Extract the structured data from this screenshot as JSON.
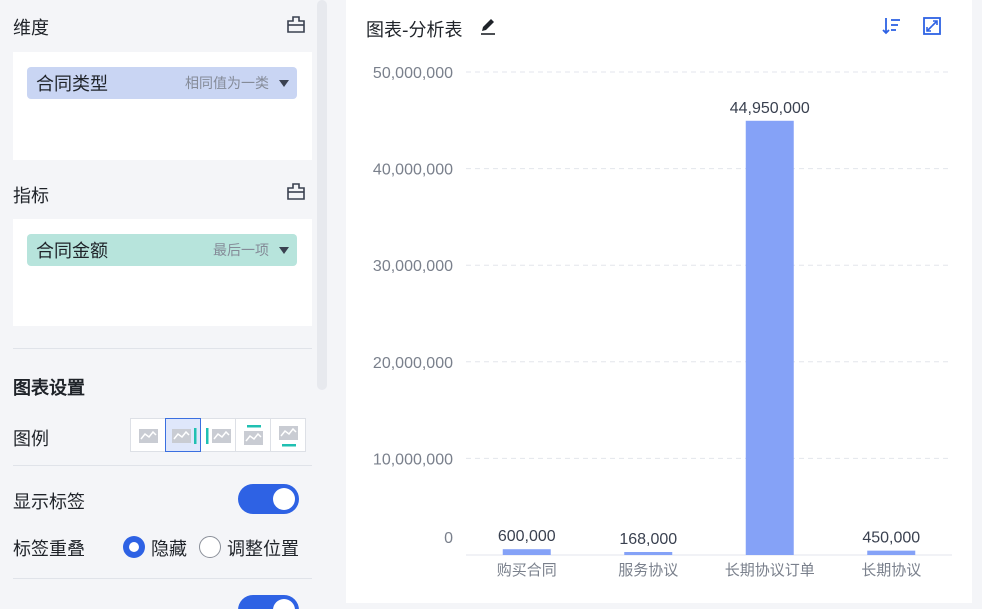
{
  "sidebar": {
    "dimension_title": "维度",
    "dimension_field": {
      "name": "合同类型",
      "aggregation": "相同值为一类"
    },
    "measure_title": "指标",
    "measure_field": {
      "name": "合同金额",
      "aggregation": "最后一项"
    },
    "chart_settings_title": "图表设置",
    "legend_label": "图例",
    "legend_options": [
      "none",
      "right",
      "left",
      "top",
      "bottom"
    ],
    "legend_selected": "right",
    "show_labels_label": "显示标签",
    "show_labels_on": true,
    "label_overlap_label": "标签重叠",
    "label_overlap_options": [
      "隐藏",
      "调整位置"
    ],
    "label_overlap_selected": "隐藏",
    "colors": {
      "dimension_pill": "#c9d5f3",
      "measure_pill": "#b7e4dc",
      "accent": "#2e62e4"
    }
  },
  "chart_panel": {
    "title": "图表-分析表"
  },
  "chart_data": {
    "type": "bar",
    "categories": [
      "购买合同",
      "服务协议",
      "长期协议订单",
      "长期协议"
    ],
    "values": [
      600000,
      168000,
      44950000,
      450000
    ],
    "value_labels": [
      "600,000",
      "168,000",
      "44,950,000",
      "450,000"
    ],
    "ylim": [
      0,
      50000000
    ],
    "yticks": [
      0,
      10000000,
      20000000,
      30000000,
      40000000,
      50000000
    ],
    "ytick_labels": [
      "0",
      "10,000,000",
      "20,000,000",
      "30,000,000",
      "40,000,000",
      "50,000,000"
    ],
    "grid": true,
    "bar_color": "#85a2f7"
  }
}
